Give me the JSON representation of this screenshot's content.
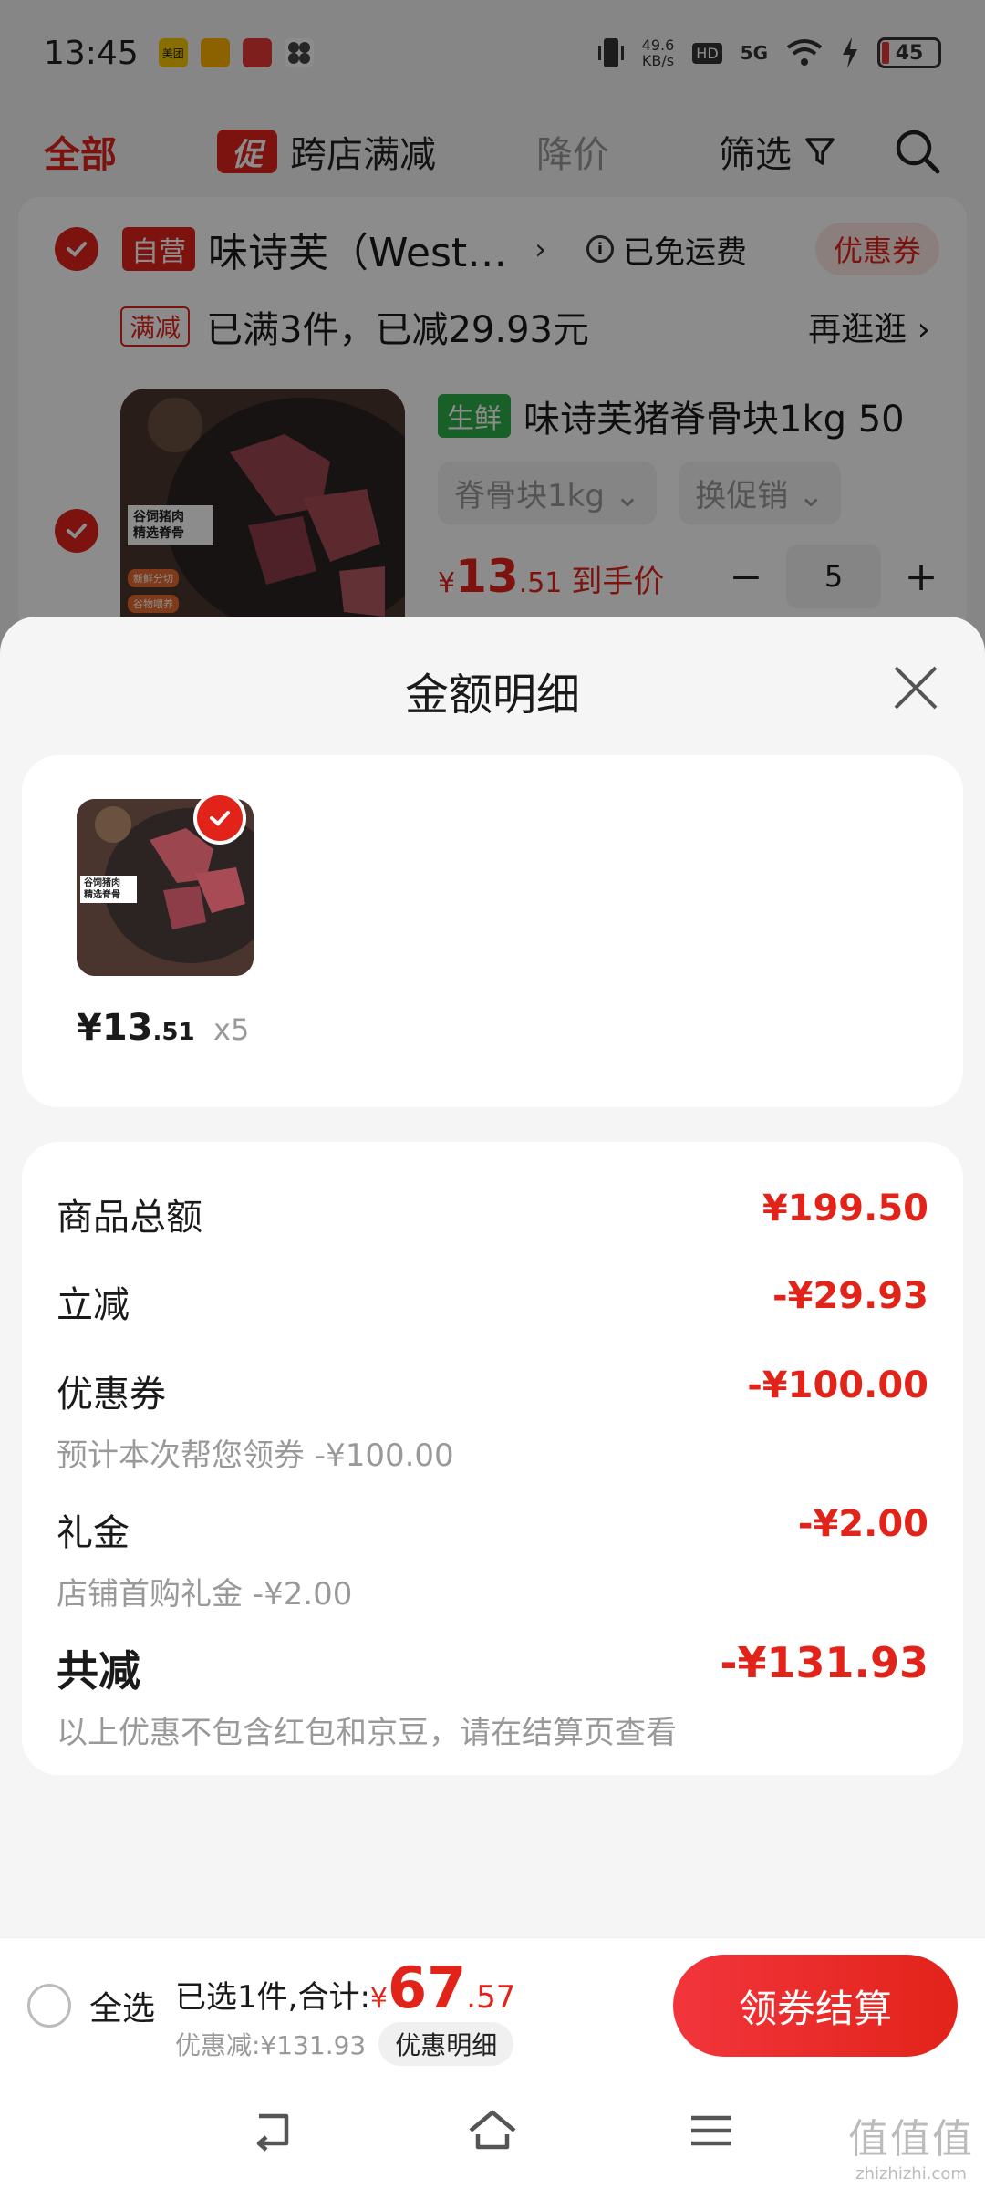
{
  "status_bar": {
    "time": "13:45",
    "app_icons": [
      "美团",
      "",
      "",
      ""
    ],
    "net_speed_value": "49.6",
    "net_speed_unit": "KB/s",
    "hd": "HD",
    "network": "5G",
    "battery": "45"
  },
  "filter_bar": {
    "all": "全部",
    "promo_badge": "促",
    "cross_store": "跨店满减",
    "price_drop": "降价",
    "filter": "筛选"
  },
  "store": {
    "self_tag": "自营",
    "name": "味诗芙（West…",
    "free_shipping": "已免运费",
    "coupon": "优惠券",
    "manjian_tag": "满减",
    "manjian_text": "已满3件，已减29.93元",
    "browse_more": "再逛逛 ›"
  },
  "product": {
    "fresh_tag": "生鲜",
    "title": "味诗芙猪脊骨块1kg 50",
    "spec": "脊骨块1kg ⌄",
    "promo_switch": "换促销 ⌄",
    "price_yen": "¥",
    "price_int": "13",
    "price_dec": ".51",
    "price_suffix": "到手价",
    "minus": "−",
    "qty": "5",
    "plus": "+",
    "image_text_1": "谷饲猪肉",
    "image_text_2": "精选脊骨",
    "image_tag_1": "新鲜分切",
    "image_tag_2": "谷物喂养"
  },
  "sheet": {
    "title": "金额明细",
    "item": {
      "price_int": "¥13",
      "price_dec": ".51",
      "qty": "x5",
      "img_text_1": "谷饲猪肉",
      "img_text_2": "精选脊骨"
    },
    "rows": {
      "goods_total_label": "商品总额",
      "goods_total_value": "¥199.50",
      "instant_label": "立减",
      "instant_value": "-¥29.93",
      "coupon_label": "优惠券",
      "coupon_sub": "预计本次帮您领券 -¥100.00",
      "coupon_value": "-¥100.00",
      "gift_label": "礼金",
      "gift_sub": "店铺首购礼金 -¥2.00",
      "gift_value": "-¥2.00",
      "total_label": "共减",
      "total_sub": "以上优惠不包含红包和京豆，请在结算页查看",
      "total_value": "-¥131.93"
    }
  },
  "checkout": {
    "select_all": "全选",
    "selected_prefix": "已选1件,合计:",
    "yen": "¥",
    "total_int": "67",
    "total_dec": ".57",
    "discount": "优惠减:¥131.93",
    "detail_pill": "优惠明细",
    "button": "领券结算"
  },
  "watermark": {
    "big": "值值值",
    "small": "zhizhizhi.com"
  },
  "colors": {
    "accent": "#e2231a",
    "fresh_green": "#2eae4a",
    "muted": "#999999"
  },
  "icons": [
    "close-icon",
    "search-icon",
    "filter-funnel-icon",
    "check-icon",
    "back-nav-icon",
    "home-nav-icon",
    "menu-nav-icon",
    "info-icon"
  ]
}
